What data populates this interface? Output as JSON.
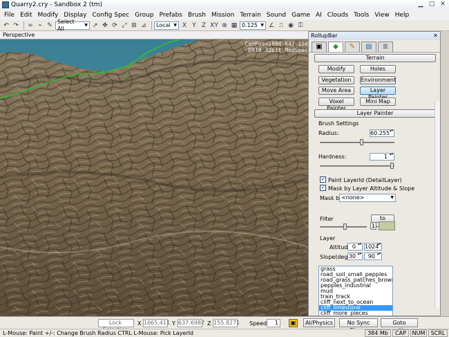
{
  "window": {
    "title": "Quarry2.cry - Sandbox 2 (tm)"
  },
  "menu": [
    "File",
    "Edit",
    "Modify",
    "Display",
    "Config Spec",
    "Group",
    "Prefabs",
    "Brush",
    "Mission",
    "Terrain",
    "Sound",
    "Game",
    "AI",
    "Clouds",
    "Tools",
    "View",
    "Help"
  ],
  "toolbar": {
    "selection": "Select All",
    "coord_system": "Local",
    "axes": [
      "X",
      "Y",
      "Z",
      "XY"
    ],
    "snap_value": "0.125"
  },
  "viewport": {
    "label": "Perspective",
    "hud_line1": "CamPos=1694 647 150",
    "hud_line2": "DX10 32bit MedSpec"
  },
  "rollup": {
    "title": "RollupBar",
    "tab_icons": [
      "objects-icon",
      "terrain-icon",
      "modelling-icon",
      "display-icon",
      "layers-icon"
    ],
    "terrain_header": "Terrain",
    "buttons": [
      "Modify",
      "Holes",
      "Vegetation",
      "Environment",
      "Move Area",
      "Layer Painter",
      "Voxel Painter",
      "Mini Map"
    ],
    "layer_painter_header": "Layer Painter",
    "brush_settings": "Brush Settings",
    "radius_label": "Radius:",
    "radius_value": "60.255",
    "hardness_label": "Hardness:",
    "hardness_value": "1",
    "paint_layer_id": "Paint LayerId (DetailLayer)",
    "mask_altitude": "Mask by Layer Altitude & Slope",
    "mask_by_label": "Mask by",
    "mask_by_value": "<none>",
    "filter_label": "Filter",
    "to_layer": "to Layer",
    "filter_value": "1",
    "layer_label": "Layer",
    "altitude_label": "Altitude",
    "altitude_min": "0",
    "altitude_max": "1024",
    "slope_label": "Slope(deg.)",
    "slope_min": "30",
    "slope_max": "90",
    "layers": [
      "grass",
      "road_soil_small_pepples",
      "road_grass_patches_brown_soil",
      "pepples_industrial",
      "mud",
      "train_track",
      "cliff_next_to_ocean",
      "cliff_limestone",
      "cliff_more_pieces"
    ],
    "selected_layer": "cliff_limestone"
  },
  "status": {
    "lock_selection": "Lock Selection",
    "x_label": "X",
    "x_value": "1665.411",
    "y_label": "Y",
    "y_value": "637.6987",
    "z_label": "Z",
    "z_value": "155.8271",
    "speed_label": "Speed:",
    "speed_value": "1",
    "ai_physics": "AI/Physics",
    "no_sync": "No Sync Player",
    "goto_position": "Goto position",
    "hint": "L-Mouse: Paint  +/-: Change Brush Radius   CTRL L-Mouse: Pick LayerId",
    "memory": "384 Mb",
    "cap": "CAP",
    "num": "NUM",
    "scrl": "SCRL"
  }
}
